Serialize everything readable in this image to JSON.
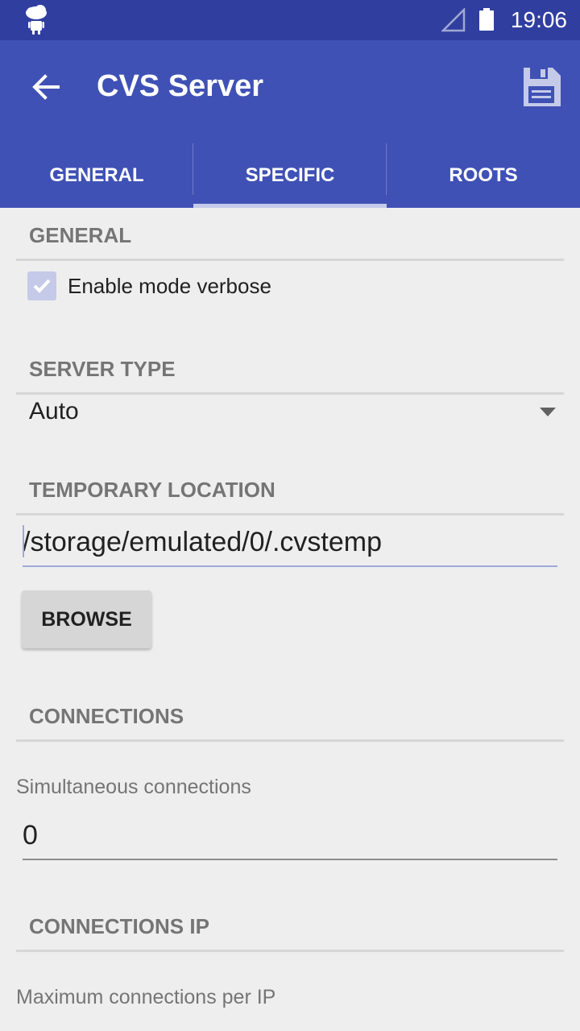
{
  "status_bar": {
    "time": "19:06"
  },
  "app_bar": {
    "title": "CVS Server"
  },
  "tabs": [
    {
      "label": "GENERAL",
      "active": false
    },
    {
      "label": "SPECIFIC",
      "active": true
    },
    {
      "label": "ROOTS",
      "active": false
    }
  ],
  "sections": {
    "general": {
      "header": "GENERAL",
      "verbose_label": "Enable mode verbose",
      "verbose_checked": true
    },
    "server_type": {
      "header": "SERVER TYPE",
      "selected": "Auto"
    },
    "temporary_location": {
      "header": "TEMPORARY LOCATION",
      "path": "/storage/emulated/0/.cvstemp",
      "browse_label": "BROWSE"
    },
    "connections": {
      "header": "CONNECTIONS",
      "simultaneous_label": "Simultaneous connections",
      "simultaneous_value": "0"
    },
    "connections_ip": {
      "header": "CONNECTIONS IP",
      "max_per_ip_label": "Maximum connections per IP"
    }
  },
  "colors": {
    "primary": "#3f51b5",
    "primary_dark": "#303f9f",
    "accent_light": "#c5cae9",
    "background": "#eeeeee"
  }
}
